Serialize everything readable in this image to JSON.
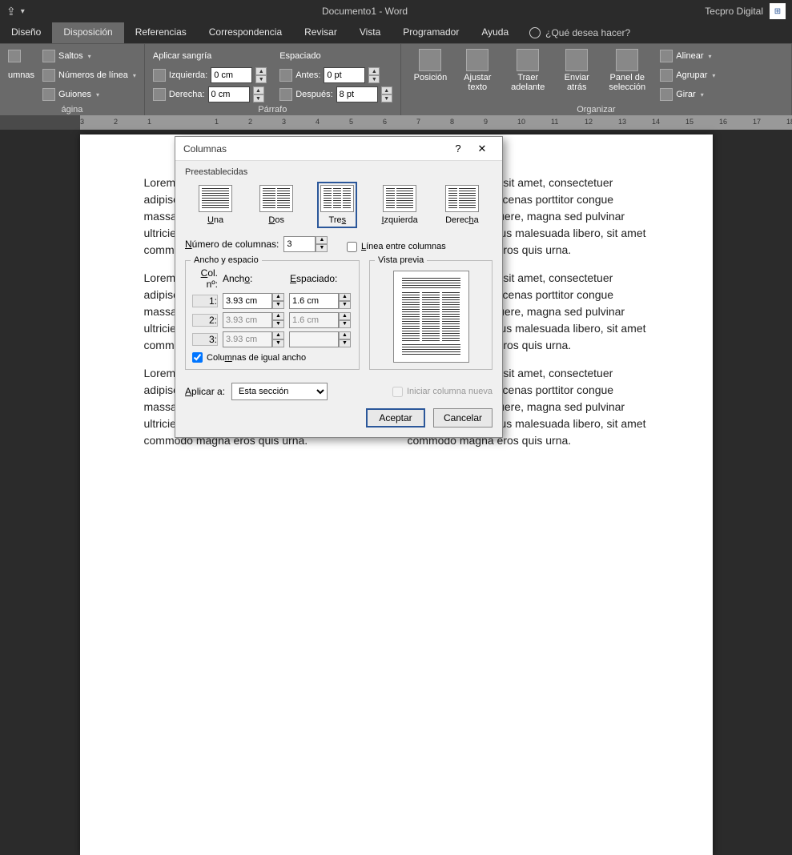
{
  "titlebar": {
    "doc_title": "Documento1 - Word",
    "account": "Tecpro Digital"
  },
  "tabs": {
    "diseno": "Diseño",
    "disposicion": "Disposición",
    "referencias": "Referencias",
    "correspondencia": "Correspondencia",
    "revisar": "Revisar",
    "vista": "Vista",
    "programador": "Programador",
    "ayuda": "Ayuda",
    "tell_me": "¿Qué desea hacer?"
  },
  "ribbon": {
    "pagina": {
      "label": "ágina",
      "saltos": "Saltos",
      "numeros_linea": "Números de línea",
      "guiones": "Guiones",
      "umnas_partial": "umnas"
    },
    "parrafo": {
      "label": "Párrafo",
      "aplicar_sangria": "Aplicar sangría",
      "izquierda": "Izquierda:",
      "derecha": "Derecha:",
      "izquierda_val": "0 cm",
      "derecha_val": "0 cm",
      "espaciado": "Espaciado",
      "antes": "Antes:",
      "despues": "Después:",
      "antes_val": "0 pt",
      "despues_val": "8 pt"
    },
    "organizar": {
      "label": "Organizar",
      "posicion": "Posición",
      "ajustar_texto": "Ajustar texto",
      "traer_adelante": "Traer adelante",
      "enviar_atras": "Enviar atrás",
      "panel_seleccion": "Panel de selección",
      "alinear": "Alinear",
      "agrupar": "Agrupar",
      "girar": "Girar"
    }
  },
  "dialog": {
    "title": "Columnas",
    "presets_label": "Preestablecidas",
    "presets": {
      "una": "Una",
      "dos": "Dos",
      "tres": "Tres",
      "izquierda": "Izquierda",
      "derecha": "Derecha"
    },
    "num_cols_label": "Número de columnas:",
    "num_cols_value": "3",
    "line_between_label": "Línea entre columnas",
    "width_spacing_legend": "Ancho y espacio",
    "preview_legend": "Vista previa",
    "col_header": "Col. nº:",
    "ancho_header": "Ancho:",
    "espaciado_header": "Espaciado:",
    "rows": [
      {
        "num": "1:",
        "ancho": "3.93 cm",
        "esp": "1.6 cm"
      },
      {
        "num": "2:",
        "ancho": "3.93 cm",
        "esp": "1.6 cm"
      },
      {
        "num": "3:",
        "ancho": "3.93 cm",
        "esp": ""
      }
    ],
    "equal_width_label": "Columnas de igual ancho",
    "apply_to_label": "Aplicar a:",
    "apply_to_value": "Esta sección",
    "start_new_col_label": "Iniciar columna nueva",
    "accept": "Aceptar",
    "cancel": "Cancelar"
  },
  "doc_text": {
    "p1": "Lorem ipsum dolor sit amet, consectetuer adipiscing elit. Maecenas porttitor congue massa. Fusce posuere, magna sed pulvinar ultricies, purus lectus malesuada libero, sit amet commodo magna eros quis urna.",
    "p2": "Lorem ipsum dolor sit amet, consectetuer adipiscing elit. Maecenas porttitor congue massa. Fusce posuere, magna sed pulvinar ultricies, purus lectus malesuada libero, sit amet commodo magna eros quis urna.",
    "p3": "Lorem ipsum dolor sit amet, consectetuer adipiscing elit. Maecenas porttitor congue massa. Fusce posuere, magna sed pulvinar ultricies, purus lectus malesuada libero, sit amet commodo magna eros quis urna."
  }
}
